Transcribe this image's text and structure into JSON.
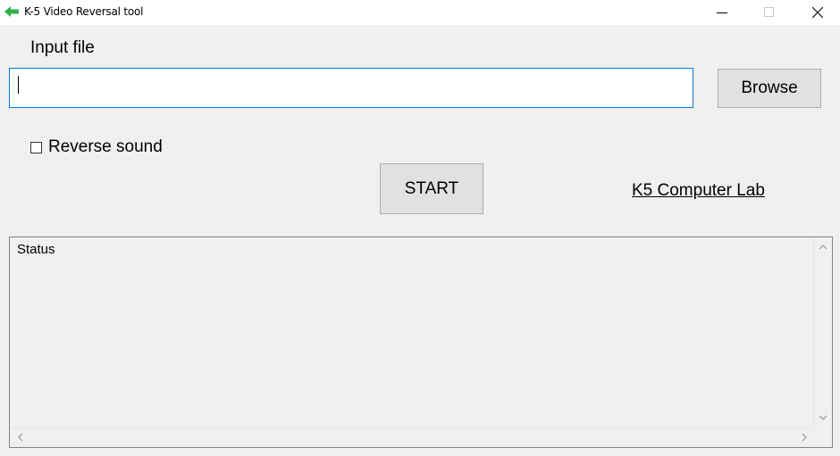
{
  "window": {
    "title": "K-5 Video Reversal tool",
    "icon": "green-arrow-left-icon",
    "controls": [
      "minimize",
      "maximize",
      "close"
    ]
  },
  "form": {
    "input_label": "Input file",
    "input_value": "",
    "input_placeholder": "",
    "browse_label": "Browse",
    "reverse_sound_label": "Reverse sound",
    "reverse_sound_checked": false,
    "start_label": "START",
    "link_label": "K5 Computer Lab"
  },
  "status": {
    "text": "Status"
  },
  "colors": {
    "accent": "#0078d7",
    "icon_green": "#2fb24c",
    "background": "#f0f0f0"
  }
}
